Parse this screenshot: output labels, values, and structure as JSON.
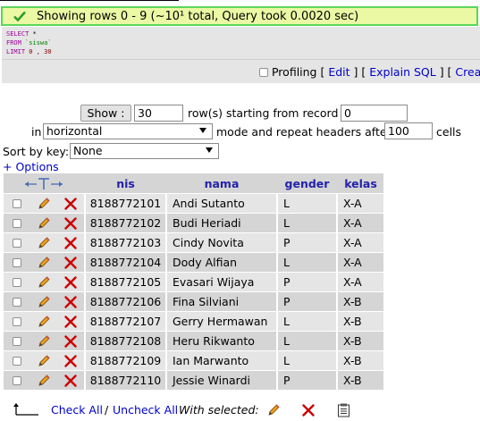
{
  "message": "Showing rows 0 - 9 (~10¹ total, Query took 0.0020 sec)",
  "sql": {
    "line1_kw": "SELECT",
    "line1_rest": " *",
    "line2_kw": "FROM",
    "line2_str": " `siswa`",
    "line3_kw": "LIMIT",
    "line3_num": " 0 , 30"
  },
  "links": {
    "profiling": "Profiling",
    "edit": "Edit",
    "explain": "Explain SQL",
    "create": "Create"
  },
  "nav": {
    "show_label": "Show :",
    "rows_value": "30",
    "rows_text": "row(s) starting from record #",
    "start_value": "0",
    "in_label": "in",
    "mode_value": "horizontal",
    "mode_text": "mode and repeat headers after",
    "repeat_value": "100",
    "cells_text": "cells",
    "sort_label": "Sort by key:",
    "sort_value": "None",
    "options_link": "+ Options"
  },
  "table": {
    "columns": [
      "nis",
      "nama",
      "gender",
      "kelas"
    ],
    "rows": [
      {
        "nis": "8188772101",
        "nama": "Andi Sutanto",
        "gender": "L",
        "kelas": "X-A"
      },
      {
        "nis": "8188772102",
        "nama": "Budi Heriadi",
        "gender": "L",
        "kelas": "X-A"
      },
      {
        "nis": "8188772103",
        "nama": "Cindy Novita",
        "gender": "P",
        "kelas": "X-A"
      },
      {
        "nis": "8188772104",
        "nama": "Dody Alfian",
        "gender": "L",
        "kelas": "X-A"
      },
      {
        "nis": "8188772105",
        "nama": "Evasari Wijaya",
        "gender": "P",
        "kelas": "X-A"
      },
      {
        "nis": "8188772106",
        "nama": "Fina Silviani",
        "gender": "P",
        "kelas": "X-B"
      },
      {
        "nis": "8188772107",
        "nama": "Gerry Hermawan",
        "gender": "L",
        "kelas": "X-B"
      },
      {
        "nis": "8188772108",
        "nama": "Heru Rikwanto",
        "gender": "L",
        "kelas": "X-B"
      },
      {
        "nis": "8188772109",
        "nama": "Ian Marwanto",
        "gender": "L",
        "kelas": "X-B"
      },
      {
        "nis": "8188772110",
        "nama": "Jessie Winardi",
        "gender": "P",
        "kelas": "X-B"
      }
    ]
  },
  "footer": {
    "check_all": "Check All",
    "separator": "/",
    "uncheck_all": "Uncheck All",
    "with_selected": "With selected:"
  },
  "colors": {
    "success_bg": "#ebf8a4",
    "success_border": "#5ad65a",
    "header_link": "#2222aa",
    "link": "#0000cc",
    "delete_red": "#cc0000"
  }
}
